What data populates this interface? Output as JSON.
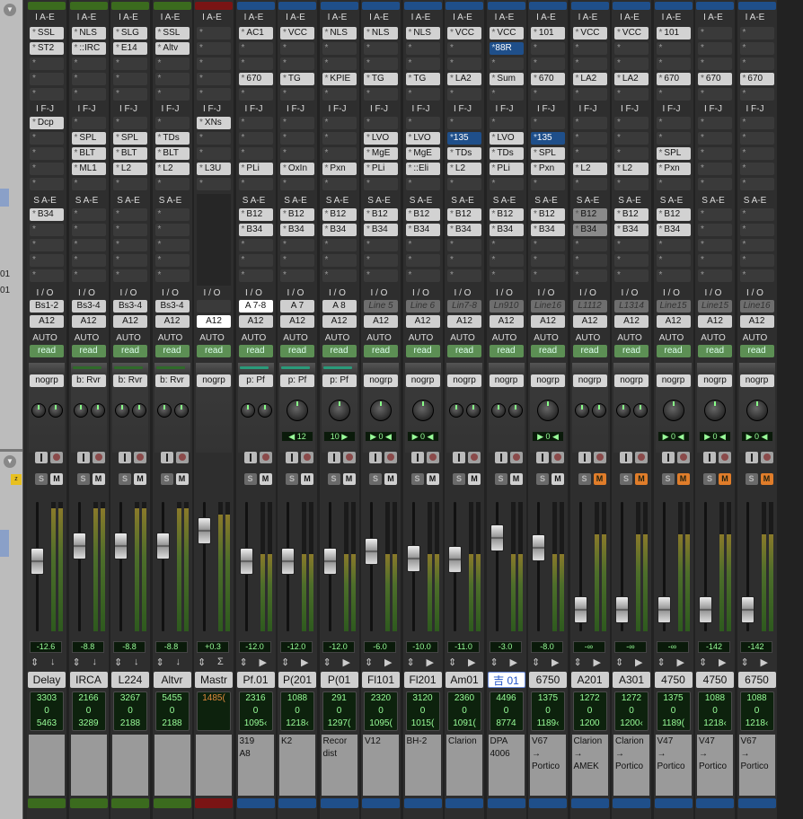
{
  "left_panel": {
    "line1": "01",
    "line2": "01",
    "collapse_icon": "triangle-down-icon"
  },
  "headers": {
    "inserts_ae": "I A-E",
    "inserts_fj": "I F-J",
    "sends_ae": "S A-E",
    "io": "I / O",
    "auto": "AUTO"
  },
  "colors": {
    "green": "#3b6b1e",
    "red": "#7a1414",
    "blue": "#1f4f8a",
    "mute_on": "#e07d2a",
    "auto_read": "#5c8f54"
  },
  "strips": [
    {
      "color": "green",
      "ins_ae": [
        "SSL",
        "ST2",
        "",
        "",
        ""
      ],
      "ins_fj": [
        "Dcp",
        "",
        "",
        "",
        ""
      ],
      "sends": [
        "B34",
        "",
        "",
        "",
        ""
      ],
      "io_in": "Bs1-2",
      "io_in_style": "",
      "io_out": "A12",
      "auto": "read",
      "group": "nogrp",
      "group_line": "",
      "pan": "dual",
      "pan_val": "",
      "mute": false,
      "vol": "-12.6",
      "arrow": "↓",
      "name": "Delay",
      "c1": "3303",
      "c2": "0",
      "c3": "5463",
      "comment": "",
      "fader": 0.55,
      "meter": 0.95
    },
    {
      "color": "green",
      "ins_ae": [
        "NLS",
        "::IRC",
        "",
        "",
        ""
      ],
      "ins_fj": [
        "",
        "SPL",
        "BLT",
        "ML1",
        ""
      ],
      "sends": [
        "",
        "",
        "",
        "",
        ""
      ],
      "io_in": "Bs3-4",
      "io_in_style": "",
      "io_out": "A12",
      "auto": "read",
      "group": "b: Rvr",
      "group_line": "#2f6a2a",
      "pan": "dual",
      "pan_val": "",
      "mute": false,
      "vol": "-8.8",
      "arrow": "↓",
      "name": "IRCA",
      "c1": "2166",
      "c2": "0",
      "c3": "3289",
      "comment": "",
      "fader": 0.7,
      "meter": 0.95
    },
    {
      "color": "green",
      "ins_ae": [
        "SLG",
        "E14",
        "",
        "",
        ""
      ],
      "ins_fj": [
        "",
        "SPL",
        "BLT",
        "L2",
        ""
      ],
      "sends": [
        "",
        "",
        "",
        "",
        ""
      ],
      "io_in": "Bs3-4",
      "io_in_style": "",
      "io_out": "A12",
      "auto": "read",
      "group": "b: Rvr",
      "group_line": "#2f6a2a",
      "pan": "dual",
      "pan_val": "",
      "mute": false,
      "vol": "-8.8",
      "arrow": "↓",
      "name": "L224",
      "c1": "3267",
      "c2": "0",
      "c3": "2188",
      "comment": "",
      "fader": 0.7,
      "meter": 0.95
    },
    {
      "color": "green",
      "ins_ae": [
        "SSL",
        "Altv",
        "",
        "",
        ""
      ],
      "ins_fj": [
        "",
        "TDs",
        "BLT",
        "L2",
        ""
      ],
      "sends": [
        "",
        "",
        "",
        "",
        ""
      ],
      "io_in": "Bs3-4",
      "io_in_style": "",
      "io_out": "A12",
      "auto": "read",
      "group": "b: Rvr",
      "group_line": "#2f6a2a",
      "pan": "dual",
      "pan_val": "",
      "mute": false,
      "vol": "-8.8",
      "arrow": "↓",
      "name": "Altvr",
      "c1": "5455",
      "c2": "0",
      "c3": "2188",
      "comment": "",
      "fader": 0.7,
      "meter": 0.95
    },
    {
      "color": "red",
      "ins_ae": [
        "",
        "",
        "",
        "",
        ""
      ],
      "ins_fj": [
        "XNs",
        "",
        "",
        "L3U",
        ""
      ],
      "sends": [],
      "io_in": "",
      "io_in_style": "dark",
      "io_out": "A12",
      "auto": "read",
      "group": "nogrp",
      "group_line": "",
      "pan": "none",
      "pan_val": "",
      "mute": false,
      "vol": "+0.3",
      "arrow": "Σ",
      "name": "Mastr",
      "c1": "1485(",
      "c2": "",
      "c3": "",
      "comment": "",
      "fader": 0.85,
      "meter": 0.9
    },
    {
      "color": "blue",
      "ins_ae": [
        "AC1",
        "",
        "",
        "670",
        ""
      ],
      "ins_fj": [
        "",
        "",
        "",
        "PLi",
        ""
      ],
      "sends": [
        "B12",
        "B34",
        "",
        "",
        ""
      ],
      "io_in": "A 7-8",
      "io_in_style": "white",
      "io_out": "A12",
      "auto": "read",
      "group": "p: Pf",
      "group_line": "#2a9a7a",
      "pan": "dual",
      "pan_val": "",
      "mute": false,
      "vol": "-12.0",
      "arrow": "▶",
      "name": "Pf.01",
      "c1": "2316",
      "c2": "0",
      "c3": "1095‹",
      "comment": "319\nA8",
      "fader": 0.55,
      "meter": 0.6
    },
    {
      "color": "blue",
      "ins_ae": [
        "VCC",
        "",
        "",
        "TG",
        ""
      ],
      "ins_fj": [
        "",
        "",
        "",
        "OxIn",
        ""
      ],
      "sends": [
        "B12",
        "B34",
        "",
        "",
        ""
      ],
      "io_in": "A 7",
      "io_in_style": "",
      "io_out": "A12",
      "auto": "read",
      "group": "p: Pf",
      "group_line": "#2a9a7a",
      "pan": "single",
      "pan_val": "◀ 12",
      "mute": false,
      "vol": "-12.0",
      "arrow": "▶",
      "name": "P(201",
      "c1": "1088",
      "c2": "0",
      "c3": "1218‹",
      "comment": "K2",
      "fader": 0.55,
      "meter": 0.6
    },
    {
      "color": "blue",
      "ins_ae": [
        "NLS",
        "",
        "",
        "KPIE",
        ""
      ],
      "ins_fj": [
        "",
        "",
        "",
        "Pxn",
        ""
      ],
      "sends": [
        "B12",
        "B34",
        "",
        "",
        ""
      ],
      "io_in": "A 8",
      "io_in_style": "",
      "io_out": "A12",
      "auto": "read",
      "group": "p: Pf",
      "group_line": "#2a9a7a",
      "pan": "single",
      "pan_val": "10 ▶",
      "mute": false,
      "vol": "-12.0",
      "arrow": "▶",
      "name": "P(01",
      "c1": "291",
      "c2": "0",
      "c3": "1297(",
      "comment": "Recor\ndist",
      "fader": 0.55,
      "meter": 0.6
    },
    {
      "color": "blue",
      "ins_ae": [
        "NLS",
        "",
        "",
        "TG",
        ""
      ],
      "ins_fj": [
        "",
        "LVO",
        "MgE",
        "PLi",
        ""
      ],
      "sends": [
        "B12",
        "B34",
        "",
        "",
        ""
      ],
      "io_in": "Line 5",
      "io_in_style": "grey",
      "io_out": "A12",
      "auto": "read",
      "group": "nogrp",
      "group_line": "",
      "pan": "single",
      "pan_val": "▶ 0 ◀",
      "mute": false,
      "vol": "-6.0",
      "arrow": "▶",
      "name": "Fl101",
      "c1": "2320",
      "c2": "0",
      "c3": "1095(",
      "comment": "V12",
      "fader": 0.65,
      "meter": 0.6
    },
    {
      "color": "blue",
      "ins_ae": [
        "NLS",
        "",
        "",
        "TG",
        ""
      ],
      "ins_fj": [
        "",
        "LVO",
        "MgE",
        "::Eli",
        ""
      ],
      "sends": [
        "B12",
        "B34",
        "",
        "",
        ""
      ],
      "io_in": "Line 6",
      "io_in_style": "grey",
      "io_out": "A12",
      "auto": "read",
      "group": "nogrp",
      "group_line": "",
      "pan": "single",
      "pan_val": "▶ 0 ◀",
      "mute": false,
      "vol": "-10.0",
      "arrow": "▶",
      "name": "Fl201",
      "c1": "3120",
      "c2": "0",
      "c3": "1015(",
      "comment": "BH-2",
      "fader": 0.58,
      "meter": 0.6
    },
    {
      "color": "blue",
      "ins_ae": [
        "VCC",
        "",
        "",
        "LA2",
        ""
      ],
      "ins_fj": [
        "",
        "135",
        "TDs",
        "L2",
        ""
      ],
      "ins_fj_blue": [
        1
      ],
      "sends": [
        "B12",
        "B34",
        "",
        "",
        ""
      ],
      "io_in": "Lin7-8",
      "io_in_style": "grey",
      "io_out": "A12",
      "auto": "read",
      "group": "nogrp",
      "group_line": "",
      "pan": "dual",
      "pan_val": "",
      "mute": false,
      "vol": "-11.0",
      "arrow": "▶",
      "name": "Am01",
      "c1": "2360",
      "c2": "0",
      "c3": "1091(",
      "comment": "Clarion",
      "fader": 0.57,
      "meter": 0.6
    },
    {
      "color": "blue",
      "ins_ae": [
        "VCC",
        "88R",
        "",
        "Sum",
        ""
      ],
      "ins_ae_blue": [
        1
      ],
      "ins_fj": [
        "",
        "LVO",
        "TDs",
        "PLi",
        ""
      ],
      "sends": [
        "B12",
        "B34",
        "",
        "",
        ""
      ],
      "io_in": "Ln910",
      "io_in_style": "grey",
      "io_out": "A12",
      "auto": "read",
      "group": "nogrp",
      "group_line": "",
      "pan": "dual",
      "pan_val": "",
      "mute": false,
      "vol": "-3.0",
      "arrow": "▶",
      "name": "吉 01",
      "name_sel": true,
      "c1": "4496",
      "c2": "0",
      "c3": "8774",
      "comment": "DPA\n4006",
      "fader": 0.78,
      "meter": 0.6
    },
    {
      "color": "blue",
      "ins_ae": [
        "101",
        "",
        "",
        "670",
        ""
      ],
      "ins_fj": [
        "",
        "135",
        "SPL",
        "Pxn",
        ""
      ],
      "ins_fj_blue": [
        1
      ],
      "sends": [
        "B12",
        "B34",
        "",
        "",
        ""
      ],
      "io_in": "Line16",
      "io_in_style": "grey",
      "io_out": "A12",
      "auto": "read",
      "group": "nogrp",
      "group_line": "",
      "pan": "single",
      "pan_val": "▶ 0 ◀",
      "mute": false,
      "vol": "-8.0",
      "arrow": "▶",
      "name": "6750",
      "c1": "1375",
      "c2": "0",
      "c3": "1189‹",
      "comment": "V67\n→\nPortico",
      "fader": 0.68,
      "meter": 0.6
    },
    {
      "color": "blue",
      "ins_ae": [
        "VCC",
        "",
        "",
        "LA2",
        ""
      ],
      "ins_fj": [
        "",
        "",
        "",
        "L2",
        ""
      ],
      "sends": [
        "B12",
        "B34",
        "",
        "",
        ""
      ],
      "sends_grey": true,
      "io_in": "L1112",
      "io_in_style": "grey",
      "io_out": "A12",
      "auto": "read",
      "group": "nogrp",
      "group_line": "",
      "pan": "dual",
      "pan_val": "",
      "mute": true,
      "vol": "-∞",
      "arrow": "▶",
      "name": "A201",
      "c1": "1272",
      "c2": "0",
      "c3": "1200",
      "comment": "Clarion\n→\nAMEK",
      "fader": 0.08,
      "meter": 0.75
    },
    {
      "color": "blue",
      "ins_ae": [
        "VCC",
        "",
        "",
        "LA2",
        ""
      ],
      "ins_fj": [
        "",
        "",
        "",
        "L2",
        ""
      ],
      "sends": [
        "B12",
        "B34",
        "",
        "",
        ""
      ],
      "io_in": "L1314",
      "io_in_style": "grey",
      "io_out": "A12",
      "auto": "read",
      "group": "nogrp",
      "group_line": "",
      "pan": "dual",
      "pan_val": "",
      "mute": true,
      "vol": "-∞",
      "arrow": "▶",
      "name": "A301",
      "c1": "1272",
      "c2": "0",
      "c3": "1200‹",
      "comment": "Clarion\n→\nPortico",
      "fader": 0.08,
      "meter": 0.75
    },
    {
      "color": "blue",
      "ins_ae": [
        "101",
        "",
        "",
        "670",
        ""
      ],
      "ins_fj": [
        "",
        "",
        "SPL",
        "Pxn",
        ""
      ],
      "sends": [
        "B12",
        "B34",
        "",
        "",
        ""
      ],
      "io_in": "Line15",
      "io_in_style": "grey",
      "io_out": "A12",
      "auto": "read",
      "group": "nogrp",
      "group_line": "",
      "pan": "single",
      "pan_val": "▶ 0 ◀",
      "mute": true,
      "vol": "-∞",
      "arrow": "▶",
      "name": "4750",
      "c1": "1375",
      "c2": "0",
      "c3": "1189(",
      "comment": "V47\n→\nPortico",
      "fader": 0.08,
      "meter": 0.75
    },
    {
      "color": "blue",
      "ins_ae": [
        "",
        "",
        "",
        "670",
        ""
      ],
      "ins_fj": [
        "",
        "",
        "",
        "",
        ""
      ],
      "sends": [
        "",
        "",
        "",
        "",
        ""
      ],
      "io_in": "Line15",
      "io_in_style": "grey",
      "io_out": "A12",
      "auto": "read",
      "group": "nogrp",
      "group_line": "",
      "pan": "single",
      "pan_val": "▶ 0 ◀",
      "mute": true,
      "vol": "-142",
      "arrow": "▶",
      "name": "4750",
      "c1": "1088",
      "c2": "0",
      "c3": "1218‹",
      "comment": "V47\n→\nPortico",
      "fader": 0.08,
      "meter": 0.75
    },
    {
      "color": "blue",
      "ins_ae": [
        "",
        "",
        "",
        "670",
        ""
      ],
      "ins_fj": [
        "",
        "",
        "",
        "",
        ""
      ],
      "sends": [
        "",
        "",
        "",
        "",
        ""
      ],
      "io_in": "Line16",
      "io_in_style": "grey",
      "io_out": "A12",
      "auto": "read",
      "group": "nogrp",
      "group_line": "",
      "pan": "single",
      "pan_val": "▶ 0 ◀",
      "mute": true,
      "vol": "-142",
      "arrow": "▶",
      "name": "6750",
      "c1": "1088",
      "c2": "0",
      "c3": "1218‹",
      "comment": "V67\n→\nPortico",
      "fader": 0.08,
      "meter": 0.75
    }
  ]
}
